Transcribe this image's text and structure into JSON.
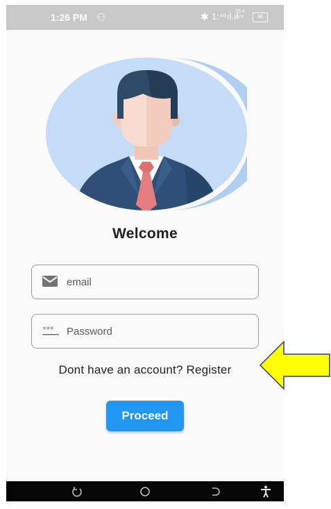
{
  "status_bar": {
    "time": "1:26 PM",
    "signal": "1:⁴⁶ıl.ıl",
    "speed_top": "29.4",
    "speed_bottom": "K/s",
    "battery": "68"
  },
  "login": {
    "title": "Welcome",
    "email_placeholder": "email",
    "password_placeholder": "Password",
    "register_prompt": "Dont have an account?",
    "register_link": "Register",
    "proceed_label": "Proceed"
  },
  "colors": {
    "primary": "#2196f3",
    "avatar_bg": "#c4dcf7",
    "annotation_arrow": "#ffff00"
  },
  "icons": {
    "email": "mail-icon",
    "password": "password-dots-icon",
    "nav_back": "back-icon",
    "nav_home": "home-icon",
    "nav_recent": "recent-apps-icon",
    "accessibility": "accessibility-icon"
  }
}
